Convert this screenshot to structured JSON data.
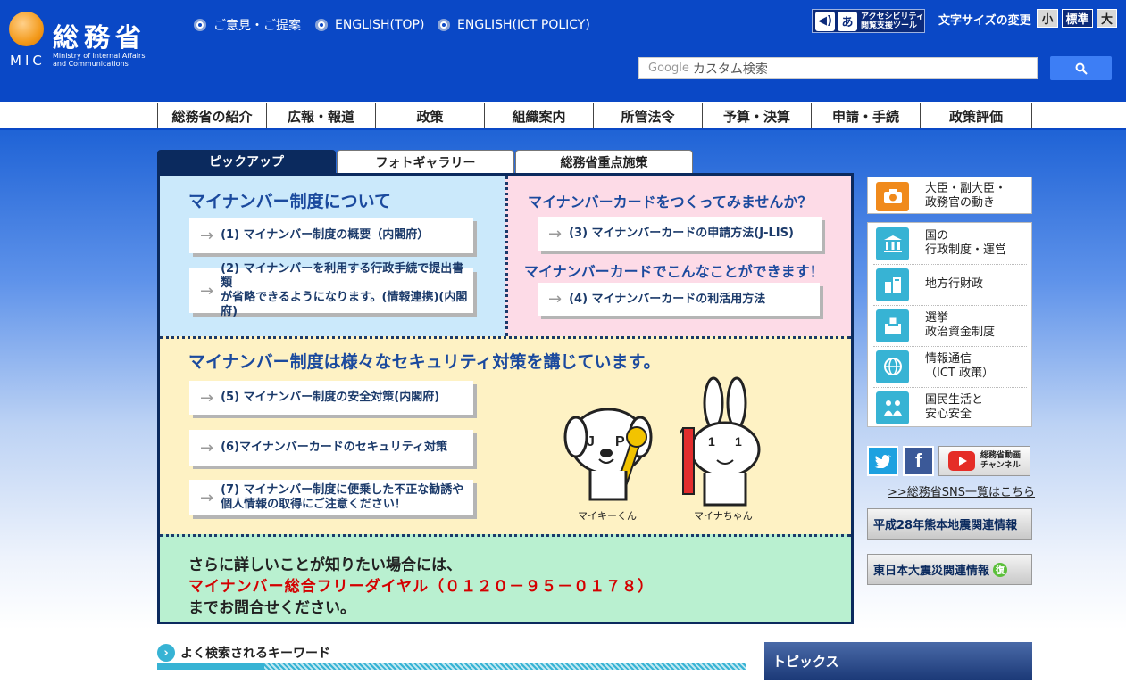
{
  "header": {
    "logo_kanji": "総務省",
    "logo_abbr": "MIC",
    "logo_en_line1": "Ministry of Internal Affairs",
    "logo_en_line2": "and Communications",
    "links": [
      "ご意見・ご提案",
      "ENGLISH(TOP)",
      "ENGLISH(ICT POLICY)"
    ],
    "accessibility_tool_line1": "アクセシビリティ",
    "accessibility_tool_line2": "閲覧支援ツール",
    "font_size_label": "文字サイズの変更",
    "font_sizes": [
      "小",
      "標準",
      "大"
    ],
    "search_placeholder": "カスタム検索",
    "search_brand": "Google"
  },
  "global_nav": [
    "総務省の紹介",
    "広報・報道",
    "政策",
    "組織案内",
    "所管法令",
    "予算・決算",
    "申請・手続",
    "政策評価"
  ],
  "tabs": [
    "ピックアップ",
    "フォトギャラリー",
    "総務省重点施策"
  ],
  "panel": {
    "q1_heading": "マイナンバー制度について",
    "q1_links": [
      "(1) マイナンバー制度の概要（内閣府）",
      "(2) マイナンバーを利用する行政手続で提出書類\nが省略できるようになります。(情報連携)(内閣府)"
    ],
    "q2_heading": "マイナンバーカードをつくってみませんか？",
    "q2_link1": "(3) マイナンバーカードの申請方法(J-LIS)",
    "q2_heading2": "マイナンバーカードでこんなことができます！",
    "q2_link2": "(4) マイナンバーカードの利活用方法",
    "q3_heading": "マイナンバー制度は様々なセキュリティ対策を講じています。",
    "q3_links": [
      "(5) マイナンバー制度の安全対策(内閣府)",
      "(6)マイナンバーカードのセキュリティ対策",
      "(7) マイナンバー制度に便乗した不正な勧誘や\n個人情報の取得にご注意ください！"
    ],
    "mascot1": "マイキーくん",
    "mascot2": "マイナちゃん",
    "contact_line1": "さらに詳しいことが知りたい場合には、",
    "contact_line2": "マイナンバー総合フリーダイヤル（０１２０－９５－０１７８）",
    "contact_line3": "までお問合せください。"
  },
  "sidebar": {
    "minister": "大臣・副大臣・\n政務官の動き",
    "categories": [
      {
        "label": "国の\n行政制度・運営",
        "icon": "building-icon"
      },
      {
        "label": "地方行財政",
        "icon": "city-icon"
      },
      {
        "label": "選挙\n政治資金制度",
        "icon": "ballot-box-icon"
      },
      {
        "label": "情報通信\n（ICT 政策）",
        "icon": "globe-icon"
      },
      {
        "label": "国民生活と\n安心安全",
        "icon": "family-icon"
      }
    ],
    "youtube_label_line1": "総務省動画",
    "youtube_label_line2": "チャンネル",
    "sns_link": ">>総務省SNS一覧はこちら",
    "banner1": "平成28年熊本地震関連情報",
    "banner2": "東日本大震災関連情報"
  },
  "keywords_title": "よく検索されるキーワード",
  "topics_title": "トピックス",
  "colors": {
    "header_blue": "#0a48c6",
    "panel_border": "#0b2a5e",
    "accent_cyan": "#37b3d4",
    "alert_red": "#d40000"
  }
}
